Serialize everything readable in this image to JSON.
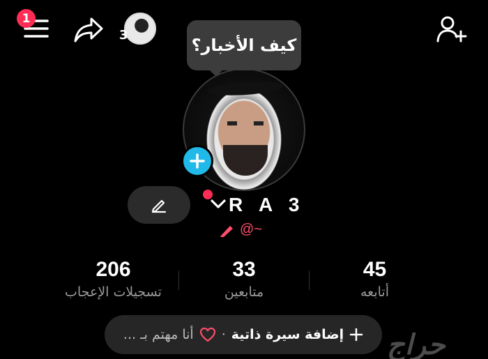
{
  "top_bar": {
    "notification_count": "1",
    "mini_avatar_count": "3",
    "icons": [
      "menu-icon",
      "share-icon",
      "add-user-icon"
    ]
  },
  "bubble_text": "كيف الأخبار؟",
  "profile": {
    "name": "R A 3",
    "handle": "@~"
  },
  "stats": [
    {
      "value": "206",
      "label": "تسجيلات الإعجاب"
    },
    {
      "value": "33",
      "label": "متابعين"
    },
    {
      "value": "45",
      "label": "أتابعه"
    }
  ],
  "bio_button": {
    "add_label": "إضافة سيرة ذاتية",
    "separator": "·",
    "interest_label": "أنا مهتم بـ ..."
  },
  "watermark": "حراج",
  "colors": {
    "accent_red": "#ff2d55",
    "plus_blue": "#20b9e8",
    "handle_pink": "#ff4d6a"
  }
}
